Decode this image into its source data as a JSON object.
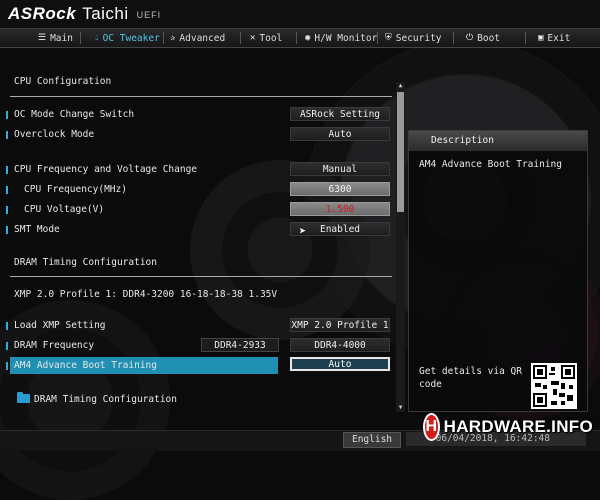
{
  "brand": {
    "name": "ASRock",
    "model": "Taichi",
    "suffix": "UEFI"
  },
  "tabs": [
    {
      "label": "Main",
      "icon": "list-icon"
    },
    {
      "label": "OC Tweaker",
      "icon": "droplet-icon"
    },
    {
      "label": "Advanced",
      "icon": "star-icon"
    },
    {
      "label": "Tool",
      "icon": "tools-icon"
    },
    {
      "label": "H/W Monitor",
      "icon": "monitor-icon"
    },
    {
      "label": "Security",
      "icon": "shield-icon"
    },
    {
      "label": "Boot",
      "icon": "power-icon"
    },
    {
      "label": "Exit",
      "icon": "exit-icon"
    }
  ],
  "section_cpu": "CPU Configuration",
  "settings": [
    {
      "label": "OC Mode Change Switch",
      "value": "ASRock Setting"
    },
    {
      "label": "Overclock Mode",
      "value": "Auto"
    },
    {
      "label": "CPU Frequency and Voltage Change",
      "value": "Manual"
    },
    {
      "label": "CPU Frequency(MHz)",
      "value": "6300"
    },
    {
      "label": "CPU Voltage(V)",
      "value": "1.500"
    },
    {
      "label": "SMT Mode",
      "value": "Enabled"
    }
  ],
  "section_dram": "DRAM Timing Configuration",
  "xmp_info": "XMP 2.0 Profile 1: DDR4-3200 16-18-18-38 1.35V",
  "dram_settings": [
    {
      "label": "Load XMP Setting",
      "value": "XMP 2.0 Profile 1"
    },
    {
      "label": "DRAM Frequency",
      "current": "DDR4-2933",
      "value": "DDR4-4000"
    },
    {
      "label": "AM4 Advance Boot Training",
      "value": "Auto"
    }
  ],
  "submenu": "DRAM Timing Configuration",
  "description": {
    "title": "Description",
    "text": "AM4 Advance Boot Training",
    "qr_text": "Get details via QR code"
  },
  "footer": {
    "language": "English",
    "datetime": "06/04/2018, 16:42:48",
    "watermark": "HARDWARE.INFO",
    "watermark_badge": "H"
  },
  "colors": {
    "accent": "#4fc7e6",
    "highlight": "#1f8fb2",
    "voltage": "#d01818"
  }
}
